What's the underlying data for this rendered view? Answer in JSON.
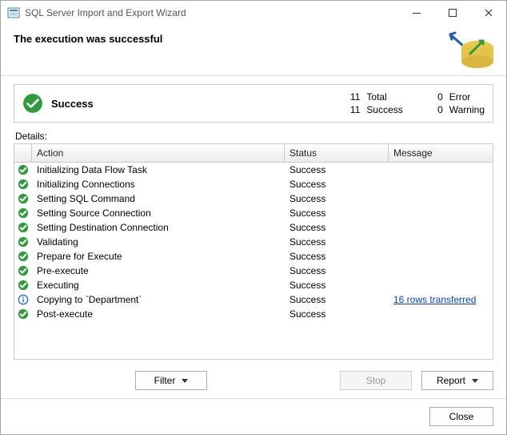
{
  "window": {
    "title": "SQL Server Import and Export Wizard"
  },
  "header": {
    "message": "The execution was successful"
  },
  "summary": {
    "label": "Success",
    "total_n": "11",
    "total_l": "Total",
    "success_n": "11",
    "success_l": "Success",
    "error_n": "0",
    "error_l": "Error",
    "warning_n": "0",
    "warning_l": "Warning"
  },
  "details": {
    "label": "Details:",
    "columns": {
      "action": "Action",
      "status": "Status",
      "message": "Message"
    },
    "rows": [
      {
        "icon": "ok",
        "action": "Initializing Data Flow Task",
        "status": "Success",
        "message": ""
      },
      {
        "icon": "ok",
        "action": "Initializing Connections",
        "status": "Success",
        "message": ""
      },
      {
        "icon": "ok",
        "action": "Setting SQL Command",
        "status": "Success",
        "message": ""
      },
      {
        "icon": "ok",
        "action": "Setting Source Connection",
        "status": "Success",
        "message": ""
      },
      {
        "icon": "ok",
        "action": "Setting Destination Connection",
        "status": "Success",
        "message": ""
      },
      {
        "icon": "ok",
        "action": "Validating",
        "status": "Success",
        "message": ""
      },
      {
        "icon": "ok",
        "action": "Prepare for Execute",
        "status": "Success",
        "message": ""
      },
      {
        "icon": "ok",
        "action": "Pre-execute",
        "status": "Success",
        "message": ""
      },
      {
        "icon": "ok",
        "action": "Executing",
        "status": "Success",
        "message": ""
      },
      {
        "icon": "info",
        "action": "Copying to `Department`",
        "status": "Success",
        "message": "16 rows transferred",
        "link": true
      },
      {
        "icon": "ok",
        "action": "Post-execute",
        "status": "Success",
        "message": ""
      }
    ]
  },
  "buttons": {
    "filter": "Filter",
    "stop": "Stop",
    "report": "Report",
    "close": "Close"
  }
}
